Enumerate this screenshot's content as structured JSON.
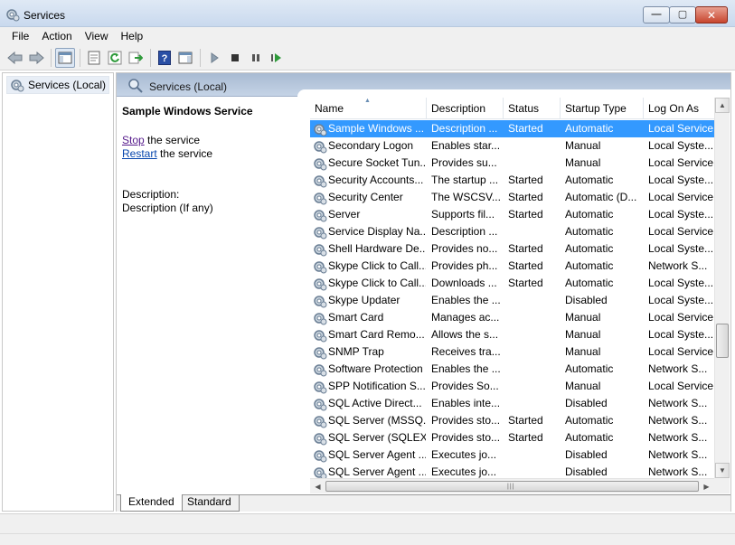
{
  "window": {
    "title": "Services"
  },
  "menu": [
    "File",
    "Action",
    "View",
    "Help"
  ],
  "tree": {
    "root_label": "Services (Local)"
  },
  "pane": {
    "title": "Services (Local)"
  },
  "details": {
    "service_name": "Sample Windows Service",
    "stop_link": "Stop",
    "stop_suffix": " the service",
    "restart_link": "Restart",
    "restart_suffix": " the service",
    "description_label": "Description:",
    "description_value": "Description (If any)"
  },
  "columns": {
    "name": "Name",
    "description": "Description",
    "status": "Status",
    "startup": "Startup Type",
    "logon": "Log On As"
  },
  "rows": [
    {
      "name": "Sample Windows ...",
      "description": "Description ...",
      "status": "Started",
      "startup": "Automatic",
      "logon": "Local Service",
      "selected": true
    },
    {
      "name": "Secondary Logon",
      "description": "Enables star...",
      "status": "",
      "startup": "Manual",
      "logon": "Local Syste..."
    },
    {
      "name": "Secure Socket Tun...",
      "description": "Provides su...",
      "status": "",
      "startup": "Manual",
      "logon": "Local Service"
    },
    {
      "name": "Security Accounts...",
      "description": "The startup ...",
      "status": "Started",
      "startup": "Automatic",
      "logon": "Local Syste..."
    },
    {
      "name": "Security Center",
      "description": "The WSCSV...",
      "status": "Started",
      "startup": "Automatic (D...",
      "logon": "Local Service"
    },
    {
      "name": "Server",
      "description": "Supports fil...",
      "status": "Started",
      "startup": "Automatic",
      "logon": "Local Syste..."
    },
    {
      "name": "Service Display Na...",
      "description": "Description ...",
      "status": "",
      "startup": "Automatic",
      "logon": "Local Service"
    },
    {
      "name": "Shell Hardware De...",
      "description": "Provides no...",
      "status": "Started",
      "startup": "Automatic",
      "logon": "Local Syste..."
    },
    {
      "name": "Skype Click to Call...",
      "description": "Provides ph...",
      "status": "Started",
      "startup": "Automatic",
      "logon": "Network S..."
    },
    {
      "name": "Skype Click to Call...",
      "description": "Downloads ...",
      "status": "Started",
      "startup": "Automatic",
      "logon": "Local Syste..."
    },
    {
      "name": "Skype Updater",
      "description": "Enables the ...",
      "status": "",
      "startup": "Disabled",
      "logon": "Local Syste..."
    },
    {
      "name": "Smart Card",
      "description": "Manages ac...",
      "status": "",
      "startup": "Manual",
      "logon": "Local Service"
    },
    {
      "name": "Smart Card Remo...",
      "description": "Allows the s...",
      "status": "",
      "startup": "Manual",
      "logon": "Local Syste..."
    },
    {
      "name": "SNMP Trap",
      "description": "Receives tra...",
      "status": "",
      "startup": "Manual",
      "logon": "Local Service"
    },
    {
      "name": "Software Protection",
      "description": "Enables the ...",
      "status": "",
      "startup": "Automatic",
      "logon": "Network S..."
    },
    {
      "name": "SPP Notification S...",
      "description": "Provides So...",
      "status": "",
      "startup": "Manual",
      "logon": "Local Service"
    },
    {
      "name": "SQL Active Direct...",
      "description": "Enables inte...",
      "status": "",
      "startup": "Disabled",
      "logon": "Network S..."
    },
    {
      "name": "SQL Server (MSSQ...",
      "description": "Provides sto...",
      "status": "Started",
      "startup": "Automatic",
      "logon": "Network S..."
    },
    {
      "name": "SQL Server (SQLEX...",
      "description": "Provides sto...",
      "status": "Started",
      "startup": "Automatic",
      "logon": "Network S..."
    },
    {
      "name": "SQL Server Agent ...",
      "description": "Executes jo...",
      "status": "",
      "startup": "Disabled",
      "logon": "Network S..."
    },
    {
      "name": "SQL Server Agent ...",
      "description": "Executes jo...",
      "status": "",
      "startup": "Disabled",
      "logon": "Network S..."
    }
  ],
  "tabs": {
    "extended": "Extended",
    "standard": "Standard"
  },
  "colors": {
    "selection": "#3399ff",
    "link": "#0645ad",
    "header_gradient_top": "#a8bad2"
  }
}
